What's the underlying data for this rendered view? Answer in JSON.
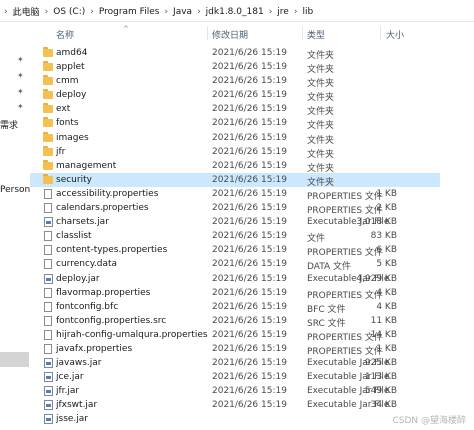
{
  "breadcrumb": {
    "items": [
      "此电脑",
      "OS (C:)",
      "Program Files",
      "Java",
      "jdk1.8.0_181",
      "jre",
      "lib"
    ]
  },
  "nav": {
    "label_1": "需求",
    "label_2": "Persona"
  },
  "columns": {
    "name": "名称",
    "date": "修改日期",
    "type": "类型",
    "size": "大小"
  },
  "files": [
    {
      "name": "amd64",
      "date": "2021/6/26 15:19",
      "type": "文件夹",
      "size": "",
      "kind": "folder"
    },
    {
      "name": "applet",
      "date": "2021/6/26 15:19",
      "type": "文件夹",
      "size": "",
      "kind": "folder"
    },
    {
      "name": "cmm",
      "date": "2021/6/26 15:19",
      "type": "文件夹",
      "size": "",
      "kind": "folder"
    },
    {
      "name": "deploy",
      "date": "2021/6/26 15:19",
      "type": "文件夹",
      "size": "",
      "kind": "folder"
    },
    {
      "name": "ext",
      "date": "2021/6/26 15:19",
      "type": "文件夹",
      "size": "",
      "kind": "folder"
    },
    {
      "name": "fonts",
      "date": "2021/6/26 15:19",
      "type": "文件夹",
      "size": "",
      "kind": "folder"
    },
    {
      "name": "images",
      "date": "2021/6/26 15:19",
      "type": "文件夹",
      "size": "",
      "kind": "folder"
    },
    {
      "name": "jfr",
      "date": "2021/6/26 15:19",
      "type": "文件夹",
      "size": "",
      "kind": "folder"
    },
    {
      "name": "management",
      "date": "2021/6/26 15:19",
      "type": "文件夹",
      "size": "",
      "kind": "folder"
    },
    {
      "name": "security",
      "date": "2021/6/26 15:19",
      "type": "文件夹",
      "size": "",
      "kind": "folder",
      "selected": true
    },
    {
      "name": "accessibility.properties",
      "date": "2021/6/26 15:19",
      "type": "PROPERTIES 文件",
      "size": "1 KB",
      "kind": "file"
    },
    {
      "name": "calendars.properties",
      "date": "2021/6/26 15:19",
      "type": "PROPERTIES 文件",
      "size": "2 KB",
      "kind": "file"
    },
    {
      "name": "charsets.jar",
      "date": "2021/6/26 15:19",
      "type": "Executable Jar File",
      "size": "3,018 KB",
      "kind": "jar"
    },
    {
      "name": "classlist",
      "date": "2021/6/26 15:19",
      "type": "文件",
      "size": "83 KB",
      "kind": "file"
    },
    {
      "name": "content-types.properties",
      "date": "2021/6/26 15:19",
      "type": "PROPERTIES 文件",
      "size": "6 KB",
      "kind": "file"
    },
    {
      "name": "currency.data",
      "date": "2021/6/26 15:19",
      "type": "DATA 文件",
      "size": "5 KB",
      "kind": "file"
    },
    {
      "name": "deploy.jar",
      "date": "2021/6/26 15:19",
      "type": "Executable Jar File",
      "size": "4,929 KB",
      "kind": "jar"
    },
    {
      "name": "flavormap.properties",
      "date": "2021/6/26 15:19",
      "type": "PROPERTIES 文件",
      "size": "4 KB",
      "kind": "file"
    },
    {
      "name": "fontconfig.bfc",
      "date": "2021/6/26 15:19",
      "type": "BFC 文件",
      "size": "4 KB",
      "kind": "file"
    },
    {
      "name": "fontconfig.properties.src",
      "date": "2021/6/26 15:19",
      "type": "SRC 文件",
      "size": "11 KB",
      "kind": "file"
    },
    {
      "name": "hijrah-config-umalqura.properties",
      "date": "2021/6/26 15:19",
      "type": "PROPERTIES 文件",
      "size": "14 KB",
      "kind": "file"
    },
    {
      "name": "javafx.properties",
      "date": "2021/6/26 15:19",
      "type": "PROPERTIES 文件",
      "size": "1 KB",
      "kind": "file"
    },
    {
      "name": "javaws.jar",
      "date": "2021/6/26 15:19",
      "type": "Executable Jar File",
      "size": "925 KB",
      "kind": "jar"
    },
    {
      "name": "jce.jar",
      "date": "2021/6/26 15:19",
      "type": "Executable Jar File",
      "size": "113 KB",
      "kind": "jar"
    },
    {
      "name": "jfr.jar",
      "date": "2021/6/26 15:19",
      "type": "Executable Jar File",
      "size": "549 KB",
      "kind": "jar"
    },
    {
      "name": "jfxswt.jar",
      "date": "2021/6/26 15:19",
      "type": "Executable Jar File",
      "size": "34 KB",
      "kind": "jar"
    },
    {
      "name": "jsse.jar",
      "date": "",
      "type": "",
      "size": "",
      "kind": "jar"
    }
  ],
  "watermark": "CSDN @望海楼醉",
  "colors": {
    "selection": "#cce8ff",
    "folder": "#f3c24e",
    "header_text": "#4c607a"
  }
}
